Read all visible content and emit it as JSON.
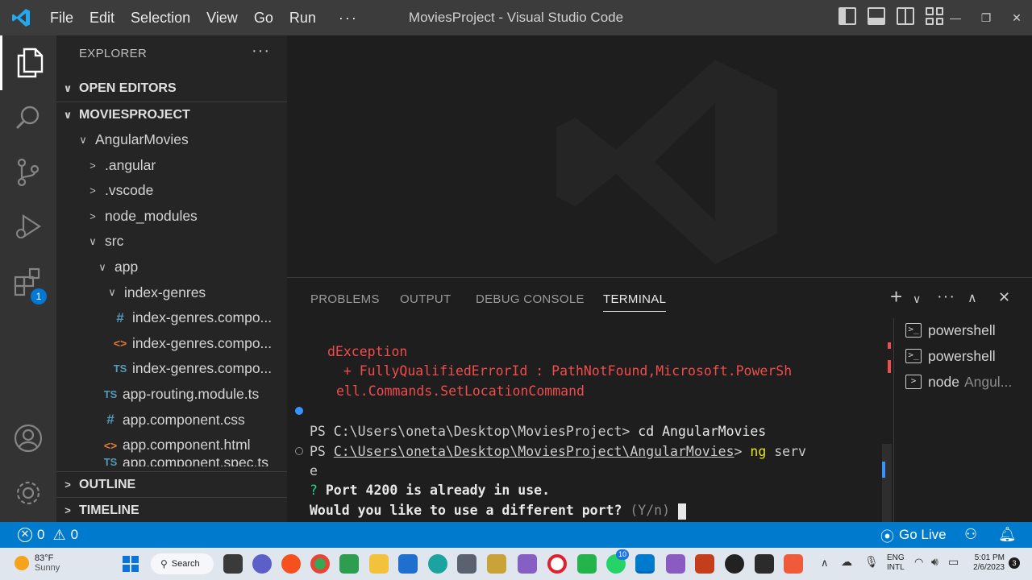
{
  "titlebar": {
    "menus": [
      "File",
      "Edit",
      "Selection",
      "View",
      "Go",
      "Run"
    ],
    "more": "···",
    "title": "MoviesProject - Visual Studio Code"
  },
  "activitybar": {
    "extensions_badge": "1"
  },
  "sidebar": {
    "title": "EXPLORER",
    "more": "···",
    "sections": {
      "open_editors": "OPEN EDITORS",
      "project": "MOVIESPROJECT",
      "outline": "OUTLINE",
      "timeline": "TIMELINE"
    },
    "tree": [
      {
        "label": "AngularMovies",
        "chev": "∨",
        "icon": "",
        "iconText": ""
      },
      {
        "label": ".angular",
        "chev": ">",
        "icon": "",
        "iconText": ""
      },
      {
        "label": ".vscode",
        "chev": ">",
        "icon": "",
        "iconText": ""
      },
      {
        "label": "node_modules",
        "chev": ">",
        "icon": "",
        "iconText": ""
      },
      {
        "label": "src",
        "chev": "∨",
        "icon": "",
        "iconText": ""
      },
      {
        "label": "app",
        "chev": "∨",
        "icon": "",
        "iconText": ""
      },
      {
        "label": "index-genres",
        "chev": "∨",
        "icon": "",
        "iconText": ""
      },
      {
        "label": "index-genres.compo...",
        "chev": "",
        "icon": "css",
        "iconText": "#"
      },
      {
        "label": "index-genres.compo...",
        "chev": "",
        "icon": "html",
        "iconText": "<>"
      },
      {
        "label": "index-genres.compo...",
        "chev": "",
        "icon": "ts",
        "iconText": "TS"
      },
      {
        "label": "app-routing.module.ts",
        "chev": "",
        "icon": "ts",
        "iconText": "TS"
      },
      {
        "label": "app.component.css",
        "chev": "",
        "icon": "css",
        "iconText": "#"
      },
      {
        "label": "app.component.html",
        "chev": "",
        "icon": "html",
        "iconText": "<>"
      },
      {
        "label": "app.component.spec.ts",
        "chev": "",
        "icon": "ts",
        "iconText": "TS"
      }
    ]
  },
  "panel": {
    "tabs": [
      "PROBLEMS",
      "OUTPUT",
      "DEBUG CONSOLE",
      "TERMINAL"
    ],
    "active_tab": "TERMINAL",
    "terminal": {
      "err1": "dException",
      "err2": "  + FullyQualifiedErrorId : PathNotFound,Microsoft.PowerSh",
      "err3": "ell.Commands.SetLocationCommand",
      "ps1": "PS C:\\Users\\oneta\\Desktop\\MoviesProject> ",
      "cmd1": "cd AngularMovies",
      "ps2_prefix": "PS ",
      "ps2_path": "C:\\Users\\oneta\\Desktop\\MoviesProject\\AngularMovies",
      "ps2_gt": "> ",
      "cmd2_ng": "ng",
      "cmd2_rest": " serv",
      "wrap": "e",
      "q_mark": "?",
      "q_text": " Port 4200 is already in use.",
      "prompt": "Would you like to use a different port?",
      "prompt_hint": " (Y/n) "
    },
    "terminals": [
      {
        "name": "powershell",
        "sub": ""
      },
      {
        "name": "powershell",
        "sub": ""
      },
      {
        "name": "node",
        "sub": "Angul..."
      }
    ]
  },
  "statusbar": {
    "errors": "0",
    "warnings": "0",
    "go_live": "Go Live"
  },
  "taskbar": {
    "weather_temp": "83°F",
    "weather_desc": "Sunny",
    "search": "Search",
    "lang1": "ENG",
    "lang2": "INTL",
    "time": "5:01 PM",
    "date": "2/6/2023",
    "notif_count": "3",
    "whatsapp_badge": "10"
  },
  "colors": {
    "accent": "#007acc",
    "error": "#f14c4c",
    "prompt_yellow": "#e5e510",
    "prompt_green": "#23d18b"
  }
}
